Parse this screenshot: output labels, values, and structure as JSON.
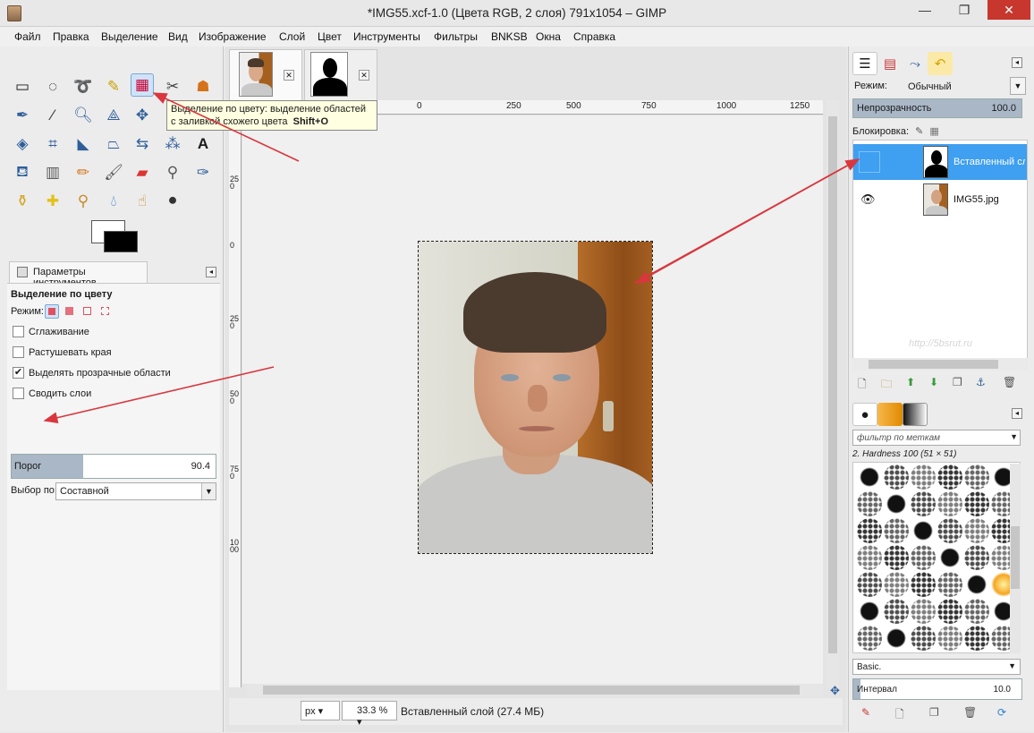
{
  "window": {
    "title": "*IMG55.xcf-1.0 (Цвета RGB, 2 слоя) 791x1054 – GIMP",
    "minimize": "—",
    "maximize": "❐",
    "close": "✕"
  },
  "menu": [
    "Файл",
    "Правка",
    "Выделение",
    "Вид",
    "Изображение",
    "Слой",
    "Цвет",
    "Инструменты",
    "Фильтры",
    "BNKSB",
    "Окна",
    "Справка"
  ],
  "tooltip": {
    "line1": "Выделение по цвету: выделение областей",
    "line2": "с заливкой схожего цвета",
    "shortcut": "Shift+O"
  },
  "tool_options": {
    "tab_label": "Параметры инструментов",
    "title": "Выделение по цвету",
    "mode_label": "Режим:",
    "checkboxes": [
      {
        "label": "Сглаживание",
        "checked": false
      },
      {
        "label": "Растушевать края",
        "checked": false
      },
      {
        "label": "Выделять прозрачные области",
        "checked": true
      },
      {
        "label": "Сводить слои",
        "checked": false
      }
    ],
    "threshold": {
      "label": "Порог",
      "value": "90.4",
      "fill_fraction": 0.35
    },
    "select_by": {
      "label": "Выбор по:",
      "value": "Составной"
    }
  },
  "image_window": {
    "ruler_ticks": [
      "0",
      "250",
      "500",
      "750",
      "1000",
      "1250"
    ],
    "ruler_left": [
      "250",
      "0",
      "250",
      "500",
      "750",
      "1000"
    ],
    "unit": "px",
    "zoom": "33.3 %",
    "status": "Вставленный слой (27.4 МБ)"
  },
  "layers": {
    "mode_label": "Режим:",
    "mode_value": "Обычный",
    "opacity_label": "Непрозрачность",
    "opacity_value": "100.0",
    "lock_label": "Блокировка:",
    "items": [
      {
        "name": "Вставленный слой",
        "selected": true
      },
      {
        "name": "IMG55.jpg",
        "selected": false
      }
    ]
  },
  "brushes": {
    "filter_placeholder": "фильтр по меткам",
    "current": "2. Hardness 100 (51 × 51)",
    "preset": "Basic.",
    "spacing_label": "Интервал",
    "spacing_value": "10.0"
  },
  "watermark": "http://5bsrut.ru",
  "colors": {
    "accent": "#3f9ff0",
    "arrow": "#d9363e",
    "tooltip_bg": "#ffffe1"
  }
}
